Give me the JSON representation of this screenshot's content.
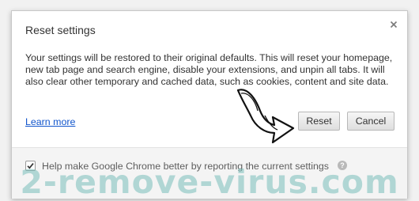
{
  "dialog": {
    "title": "Reset settings",
    "close_icon": "close-icon",
    "body_text": "Your settings will be restored to their original defaults. This will reset your homepage, new tab page and search engine, disable your extensions, and unpin all tabs. It will also clear other temporary and cached data, such as cookies, content and site data.",
    "learn_more": "Learn more",
    "reset_label": "Reset",
    "cancel_label": "Cancel"
  },
  "footer": {
    "checkbox_checked": true,
    "checkbox_label": "Help make Google Chrome better by reporting the current settings",
    "help_icon_glyph": "?"
  },
  "overlay": {
    "arrow_icon": "hand-drawn-arrow-icon",
    "watermark": "2-remove-virus.com"
  }
}
